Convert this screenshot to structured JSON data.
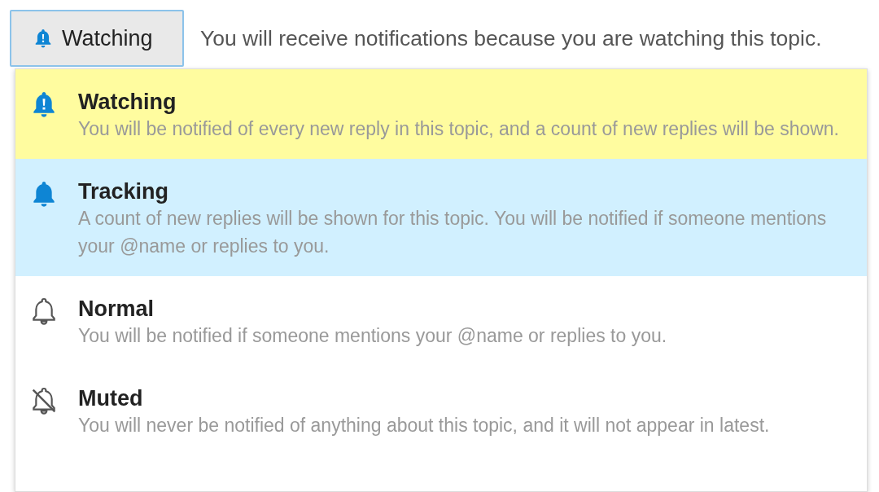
{
  "button": {
    "label": "Watching"
  },
  "status_text": "You will receive notifications because you are watching this topic.",
  "menu_items": [
    {
      "kind": "watching",
      "title": "Watching",
      "description": "You will be notified of every new reply in this topic, and a count of new replies will be shown.",
      "selected": true,
      "hovered": false
    },
    {
      "kind": "tracking",
      "title": "Tracking",
      "description": "A count of new replies will be shown for this topic. You will be notified if someone mentions your @name or replies to you.",
      "selected": false,
      "hovered": true
    },
    {
      "kind": "normal",
      "title": "Normal",
      "description": "You will be notified if someone mentions your @name or replies to you.",
      "selected": false,
      "hovered": false
    },
    {
      "kind": "muted",
      "title": "Muted",
      "description": "You will never be notified of anything about this topic, and it will not appear in latest.",
      "selected": false,
      "hovered": false
    }
  ]
}
